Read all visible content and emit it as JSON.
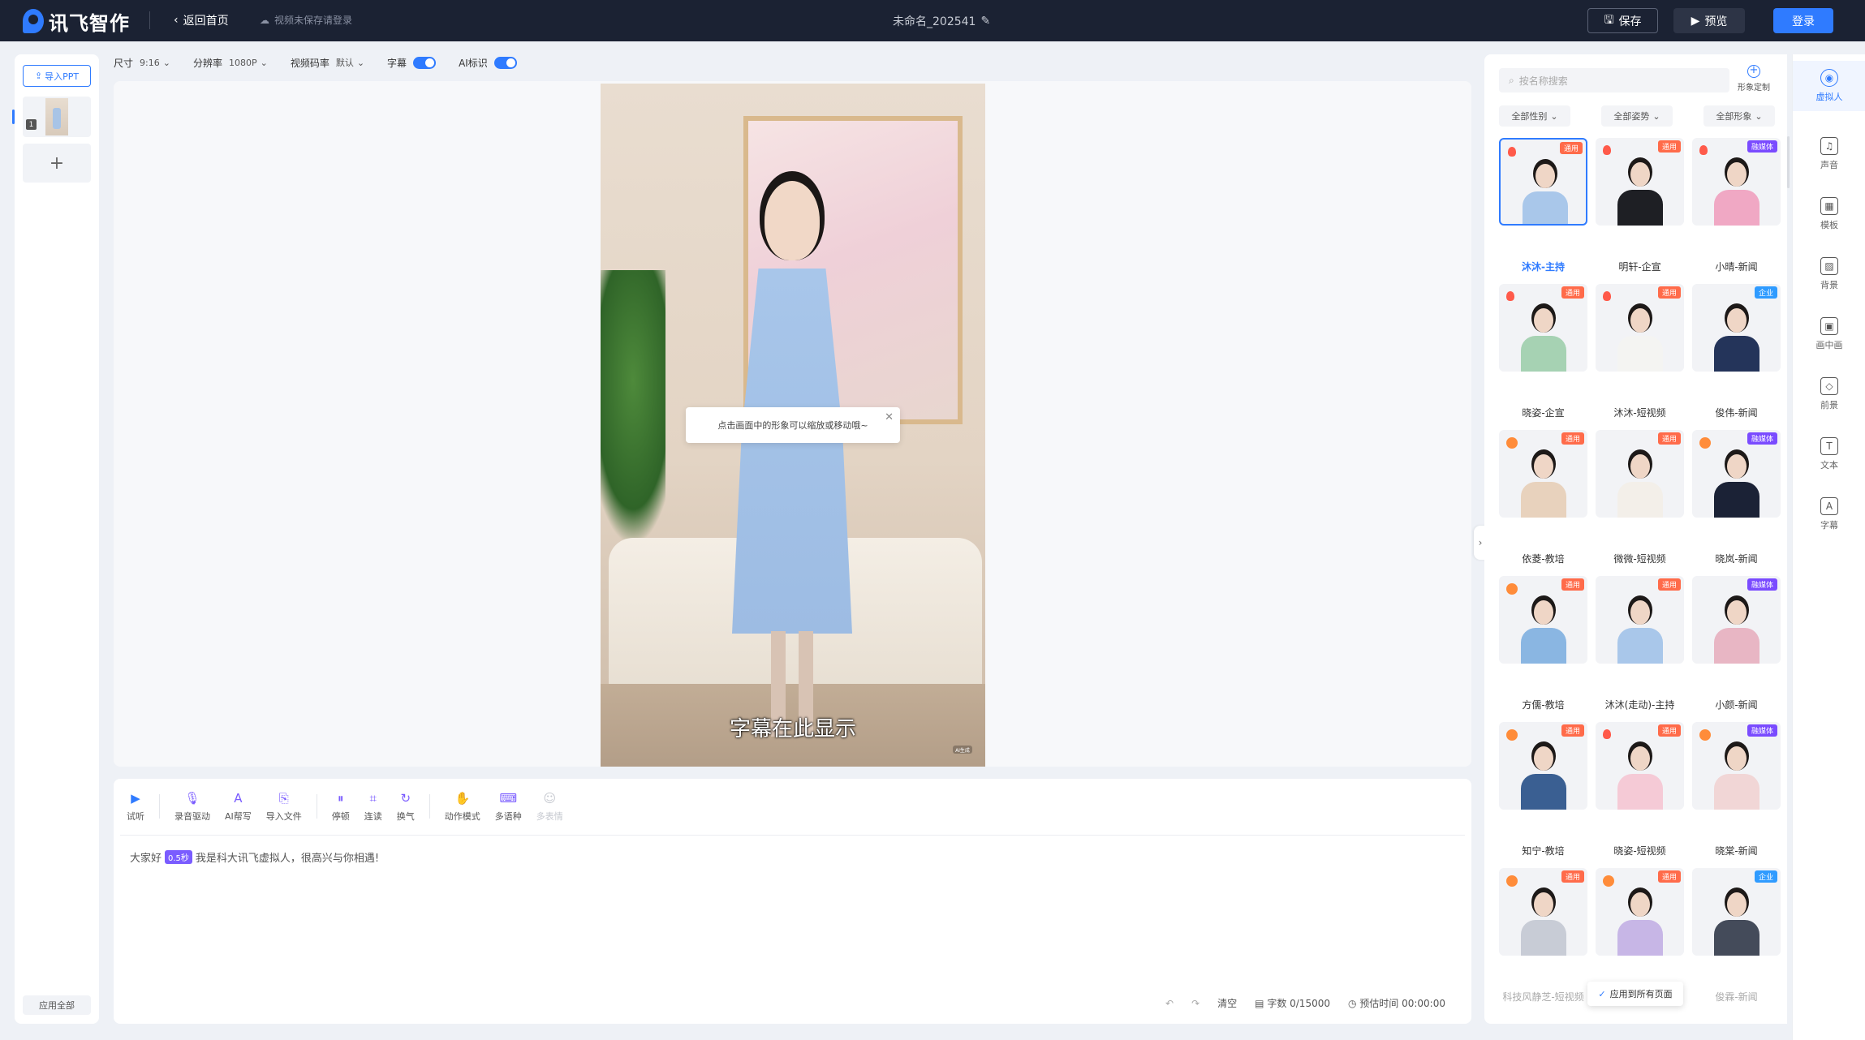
{
  "header": {
    "brand": "讯飞智作",
    "back_label": "返回首页",
    "save_hint": "视频未保存请登录",
    "doc_title": "未命名_202541",
    "save_label": "保存",
    "preview_label": "预览",
    "login_label": "登录"
  },
  "left_panel": {
    "import_label": "导入PPT",
    "slide_number": "1",
    "add_label": "+",
    "apply_all_label": "应用全部"
  },
  "settings": {
    "size_label": "尺寸",
    "size_value": "9:16",
    "resolution_label": "分辨率",
    "resolution_value": "1080P",
    "bitrate_label": "视频码率",
    "bitrate_value": "默认",
    "subtitle_label": "字幕",
    "ai_mark_label": "AI标识"
  },
  "canvas": {
    "tooltip": "点击画面中的形象可以缩放或移动哦~",
    "subtitle_text": "字幕在此显示",
    "watermark": "AI生成"
  },
  "editor": {
    "tools": [
      {
        "label": "试听",
        "icon": "play-icon"
      },
      {
        "label": "录音驱动",
        "icon": "mic-icon"
      },
      {
        "label": "AI帮写",
        "icon": "ai-write-icon"
      },
      {
        "label": "导入文件",
        "icon": "import-file-icon"
      },
      {
        "label": "停顿",
        "icon": "pause-icon"
      },
      {
        "label": "连读",
        "icon": "liaison-icon"
      },
      {
        "label": "换气",
        "icon": "breath-icon"
      },
      {
        "label": "动作模式",
        "icon": "gesture-icon"
      },
      {
        "label": "多语种",
        "icon": "language-icon"
      },
      {
        "label": "多表情",
        "icon": "emotion-icon"
      }
    ],
    "script_before": "大家好",
    "pause_tag": "0.5秒",
    "script_after": "我是科大讯飞虚拟人，很高兴与你相遇!",
    "clear_label": "清空",
    "word_count": "字数 0/15000",
    "estimated_time": "预估时间 00:00:00"
  },
  "avatar_panel": {
    "search_placeholder": "按名称搜索",
    "custom_label": "形象定制",
    "filters": [
      "全部性别",
      "全部姿势",
      "全部形象"
    ],
    "avatars": [
      {
        "name": "沐沐-主持",
        "badge": "通用",
        "badge_color": "#ff6b4a",
        "hot": "fire",
        "body": "#a9c7ea",
        "selected": true
      },
      {
        "name": "明轩-企宣",
        "badge": "通用",
        "badge_color": "#ff6b4a",
        "hot": "fire",
        "body": "#1e1f24"
      },
      {
        "name": "小晴-新闻",
        "badge": "融媒体",
        "badge_color": "#7a4bff",
        "hot": "fire",
        "body": "#f0a8c4"
      },
      {
        "name": "晓姿-企宣",
        "badge": "通用",
        "badge_color": "#ff6b4a",
        "hot": "fire",
        "body": "#a6d2b3"
      },
      {
        "name": "沐沐-短视频",
        "badge": "通用",
        "badge_color": "#ff6b4a",
        "hot": "fire",
        "body": "#f4f4f2"
      },
      {
        "name": "俊伟-新闻",
        "badge": "企业",
        "badge_color": "#2f9bff",
        "hot": "",
        "body": "#24345a"
      },
      {
        "name": "依菱-教培",
        "badge": "通用",
        "badge_color": "#ff6b4a",
        "hot": "new",
        "body": "#e8d2bd"
      },
      {
        "name": "微微-短视频",
        "badge": "通用",
        "badge_color": "#ff6b4a",
        "hot": "",
        "body": "#f3efe9"
      },
      {
        "name": "晓岚-新闻",
        "badge": "融媒体",
        "badge_color": "#7a4bff",
        "hot": "new",
        "body": "#1b2236"
      },
      {
        "name": "方儒-教培",
        "badge": "通用",
        "badge_color": "#ff6b4a",
        "hot": "new",
        "body": "#8ab6e2"
      },
      {
        "name": "沐沐(走动)-主持",
        "badge": "通用",
        "badge_color": "#ff6b4a",
        "hot": "",
        "body": "#a9c7ea"
      },
      {
        "name": "小颜-新闻",
        "badge": "融媒体",
        "badge_color": "#7a4bff",
        "hot": "",
        "body": "#e8b6c4"
      },
      {
        "name": "知宁-教培",
        "badge": "通用",
        "badge_color": "#ff6b4a",
        "hot": "new",
        "body": "#3a5f92"
      },
      {
        "name": "晓姿-短视频",
        "badge": "通用",
        "badge_color": "#ff6b4a",
        "hot": "fire",
        "body": "#f5cad6"
      },
      {
        "name": "晓棠-新闻",
        "badge": "融媒体",
        "badge_color": "#7a4bff",
        "hot": "new",
        "body": "#f1d6d6"
      },
      {
        "name": "科技风静芝-短视频",
        "badge": "通用",
        "badge_color": "#ff6b4a",
        "hot": "new",
        "body": "#c8ccd6"
      },
      {
        "name": "",
        "badge": "通用",
        "badge_color": "#ff6b4a",
        "hot": "new",
        "body": "#c7b6e6"
      },
      {
        "name": "俊霖-新闻",
        "badge": "企业",
        "badge_color": "#2f9bff",
        "hot": "",
        "body": "#444b5a"
      }
    ],
    "apply_pages_label": "应用到所有页面"
  },
  "side_nav": [
    {
      "label": "虚拟人",
      "icon": "avatar-icon",
      "active": true
    },
    {
      "label": "声音",
      "icon": "music-note-icon"
    },
    {
      "label": "模板",
      "icon": "template-icon"
    },
    {
      "label": "背景",
      "icon": "background-icon"
    },
    {
      "label": "画中画",
      "icon": "picture-in-picture-icon"
    },
    {
      "label": "前景",
      "icon": "foreground-icon"
    },
    {
      "label": "文本",
      "icon": "text-icon"
    },
    {
      "label": "字幕",
      "icon": "subtitle-icon"
    }
  ]
}
